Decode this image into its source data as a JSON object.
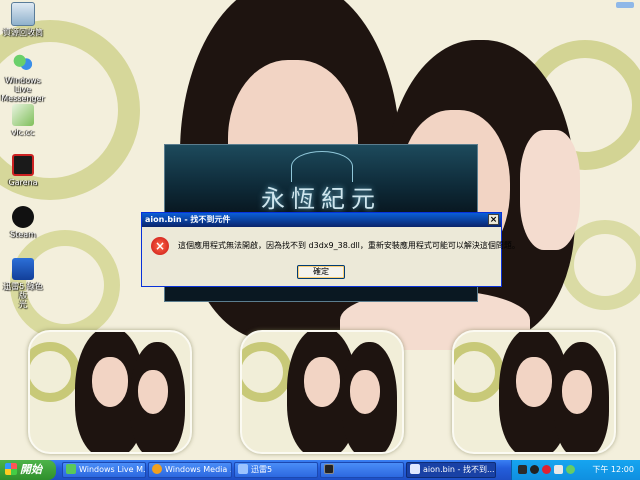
{
  "desktop": {
    "icons": [
      {
        "label": "資源回收筒",
        "name": "recycle-bin-icon"
      },
      {
        "label": "Windows Live\nMessenger",
        "name": "messenger-icon"
      },
      {
        "label": "vlc.cc",
        "name": "vlc-icon"
      },
      {
        "label": "Garena",
        "name": "garena-icon"
      },
      {
        "label": "Steam",
        "name": "steam-icon"
      },
      {
        "label": "迅雷5 綠色版\n光",
        "name": "thunder-icon"
      }
    ]
  },
  "splash": {
    "title": "永恆紀元"
  },
  "dialog": {
    "title": "aion.bin - 找不到元件",
    "message": "這個應用程式無法開啟，因為找不到 d3dx9_38.dll，重新安裝應用程式可能可以解決這個問題。",
    "ok_label": "確定",
    "close_glyph": "×",
    "error_glyph": "×"
  },
  "taskbar": {
    "start_label": "開始",
    "tasks": [
      {
        "label": "Windows Live M...",
        "icon": "messenger-icon"
      },
      {
        "label": "Windows Media ...",
        "icon": "media-player-icon"
      },
      {
        "label": "迅雷5",
        "icon": "thunder-icon"
      },
      {
        "label": "",
        "icon": "aion-icon"
      },
      {
        "label": "aion.bin - 找不到...",
        "icon": "aion-icon",
        "active": true
      }
    ],
    "clock": "下午 12:00"
  },
  "colors": {
    "taskbar": "#245edb",
    "start": "#2f8f2c",
    "tray": "#0f8fe0",
    "dialog_title": "#0a246a",
    "dialog_body": "#ece9d8"
  }
}
